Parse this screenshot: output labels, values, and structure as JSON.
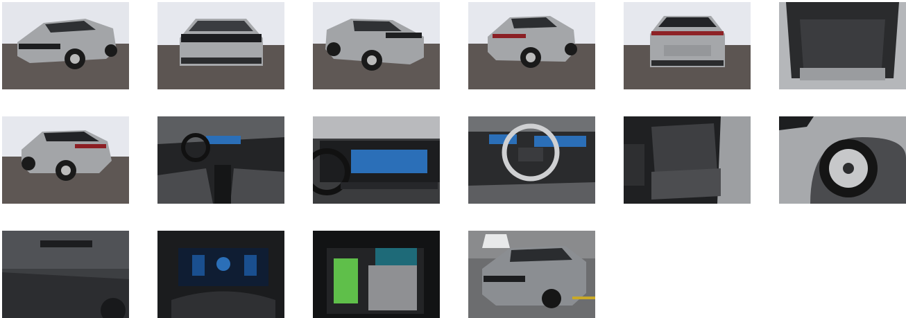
{
  "gallery": {
    "photos": [
      {
        "id": 1,
        "subject": "exterior-front-left"
      },
      {
        "id": 2,
        "subject": "exterior-front"
      },
      {
        "id": 3,
        "subject": "exterior-front-right"
      },
      {
        "id": 4,
        "subject": "exterior-rear-left"
      },
      {
        "id": 5,
        "subject": "exterior-rear"
      },
      {
        "id": 6,
        "subject": "trunk-interior"
      },
      {
        "id": 7,
        "subject": "exterior-rear-left-low"
      },
      {
        "id": 8,
        "subject": "cockpit-overview"
      },
      {
        "id": 9,
        "subject": "infotainment-display"
      },
      {
        "id": 10,
        "subject": "steering-wheel"
      },
      {
        "id": 11,
        "subject": "rear-seats"
      },
      {
        "id": 12,
        "subject": "wheel-closeup"
      },
      {
        "id": 13,
        "subject": "windshield-sticker"
      },
      {
        "id": 14,
        "subject": "instrument-cluster"
      },
      {
        "id": 15,
        "subject": "center-console-storage"
      },
      {
        "id": 16,
        "subject": "exterior-parking-garage"
      }
    ]
  },
  "colors": {
    "background": "#ffffff",
    "car_silver": "#9fa1a4",
    "studio_wall": "#e6e8ee",
    "studio_floor": "#5c5552",
    "interior_dark": "#232426",
    "screen_blue": "#2b6fb8",
    "accent_green": "#5fbf4a"
  }
}
